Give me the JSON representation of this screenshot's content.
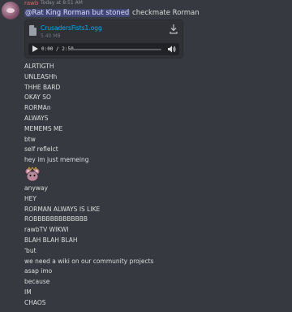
{
  "header": {
    "username": "rawb",
    "timestamp": "Today at 8:51 AM",
    "mention": "@Rat King Rorman but stoned",
    "mention_suffix": " checkmate Rorman"
  },
  "attachment": {
    "file_name": "CrusadersFists1.ogg",
    "file_size": "5.40 MB",
    "time": "0:00 / 2:50",
    "progress": 0
  },
  "messages_before_emoji": [
    "ALRTIGTH",
    "UNLEASHh",
    "THHE BARD",
    "OKAY SO",
    "RORMAn",
    "ALWAYS",
    "MEMEMS ME",
    "btw",
    "self reflelct",
    "hey im just memeing"
  ],
  "emoji": "rat-king-emoji",
  "messages_after_emoji": [
    "anyway",
    "HEY",
    "RORMAN ALWAYS IS LIKE",
    "ROBBBBBBBBBBBBB",
    "rawbTV WIKWI",
    "BLAH BLAH BLAH",
    "'but",
    "we need a wiki on our community projects",
    "asap imo",
    "because",
    "IM",
    "CHAOS"
  ]
}
